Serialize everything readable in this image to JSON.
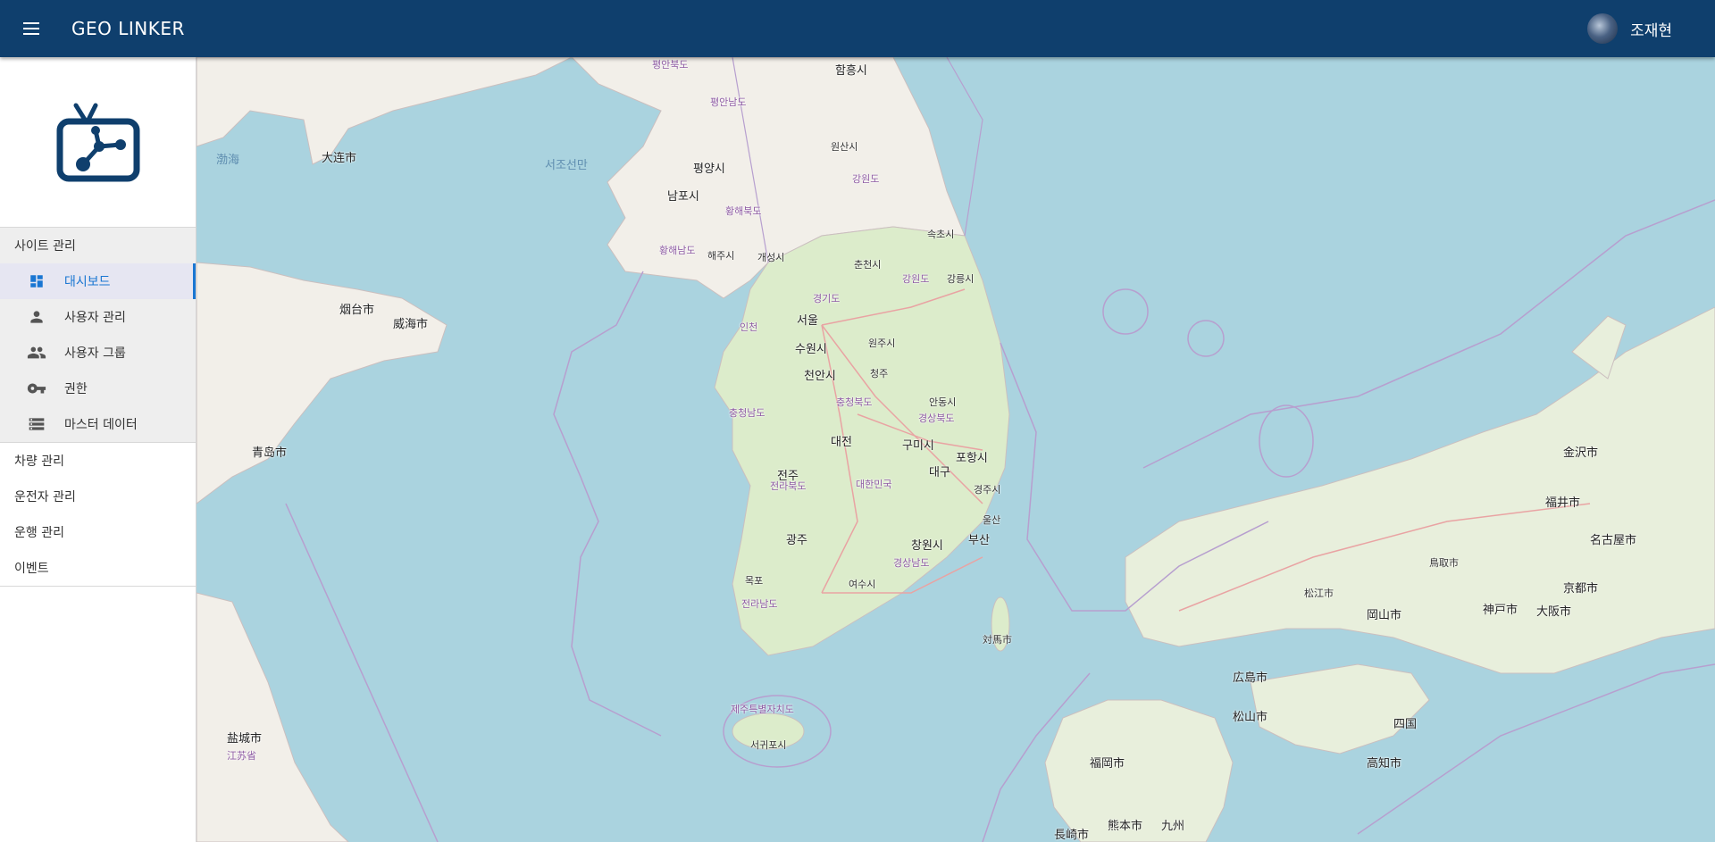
{
  "header": {
    "app_title": "GEO LINKER",
    "user_name": "조재현",
    "menu_icon": "hamburger-menu-icon",
    "bg_color": "#0f3f6d"
  },
  "sidebar": {
    "logo_icon": "tv-network-logo-icon",
    "groups": [
      {
        "title": "사이트 관리",
        "items": [
          {
            "label": "대시보드",
            "icon": "dashboard-icon",
            "active": true
          },
          {
            "label": "사용자 관리",
            "icon": "person-icon",
            "active": false
          },
          {
            "label": "사용자 그룹",
            "icon": "group-icon",
            "active": false
          },
          {
            "label": "권한",
            "icon": "key-icon",
            "active": false
          },
          {
            "label": "마스터 데이터",
            "icon": "storage-icon",
            "active": false
          }
        ]
      }
    ],
    "top_items": [
      "차량 관리",
      "운전자 관리",
      "운행 관리",
      "이벤트"
    ],
    "accent_color": "#1976d2"
  },
  "map": {
    "labels": {
      "korea": "대한민국",
      "seoul": "서울",
      "incheon": "인천",
      "suwon": "수원시",
      "daejeon": "대전",
      "daegu": "대구",
      "gwangju": "광주",
      "busan": "부산",
      "ulsan": "울산",
      "pohang": "포항시",
      "gumi": "구미시",
      "cheonan": "천안시",
      "cheongju": "청주",
      "jeonju": "전주",
      "mokpo": "목포",
      "yeosu": "여수시",
      "changwon": "창원시",
      "gangneung": "강릉시",
      "sokcho": "속초시",
      "chuncheon": "춘천시",
      "wonju": "원주시",
      "andong": "안동시",
      "gyeongju": "경주시",
      "jeju": "제주특별자치도",
      "seogwipo": "서귀포시",
      "pyongyang": "평양시",
      "nampo": "남포시",
      "wonsan": "원산시",
      "hamhung": "함흥시",
      "gaesong": "개성시",
      "haeju": "해주시",
      "gangwon_n": "강원도",
      "hwanghae_n": "황해북도",
      "hwanghae_s": "황해남도",
      "pyongan_n": "평안북도",
      "pyongan_s": "평안남도",
      "gyeonggi": "경기도",
      "gangwon": "강원도",
      "chungnam": "충청남도",
      "chungbuk": "충청북도",
      "gyeongbuk": "경상북도",
      "gyeongnam": "경상남도",
      "jeonbuk": "전라북도",
      "jeonnam": "전라남도",
      "dalian": "大连市",
      "qingdao": "青岛市",
      "yantai": "烟台市",
      "weihai": "威海市",
      "bohai": "渤海",
      "west_sea": "서조선만",
      "fukuoka": "福岡市",
      "hiroshima": "広島市",
      "osaka": "大阪市",
      "kyoto": "京都市",
      "kobe": "神戸市",
      "okayama": "岡山市",
      "matsuyama": "松山市",
      "kochi": "高知市",
      "kanazawa": "金沢市",
      "fukui": "福井市",
      "nagoya": "名古屋市",
      "kumamoto": "熊本市",
      "nagasaki": "長崎市",
      "kyushu": "九州",
      "shikoku": "四国",
      "tsushima": "対馬市",
      "tottori": "鳥取市",
      "matsue": "松江市",
      "yancheng": "盐城市",
      "jiangsu": "江苏省"
    }
  }
}
